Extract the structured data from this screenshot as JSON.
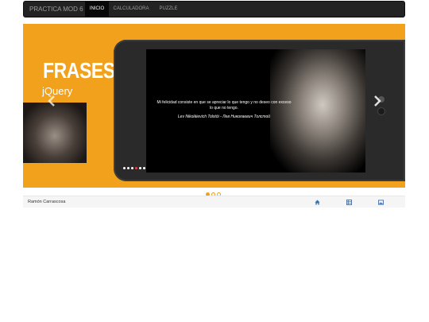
{
  "navbar": {
    "brand": "PRACTICA MOD 6",
    "items": [
      {
        "label": "INICIO",
        "active": true
      },
      {
        "label": "CALCULADORA",
        "active": false
      },
      {
        "label": "PUZZLE",
        "active": false
      }
    ]
  },
  "carousel": {
    "heading": "FRASES",
    "subheading": "jQuery",
    "quote": "Mi felicidad consiste en que se apreciar lo que tengo y no deseo con exceso lo que no tengo.",
    "author": "Lev Nikoláievich Tolstói - Лев Николаевич Толстой",
    "slide_indicators": 3,
    "active_indicator": 0,
    "screen_dots": 6,
    "active_screen_dot": 3,
    "accent_color": "#f2a11c",
    "prev_icon": "chevron-left-icon",
    "next_icon": "chevron-right-icon"
  },
  "footer": {
    "name": "Ramón Carrascosa",
    "icons": [
      "home-icon",
      "list-icon",
      "image-icon"
    ]
  }
}
